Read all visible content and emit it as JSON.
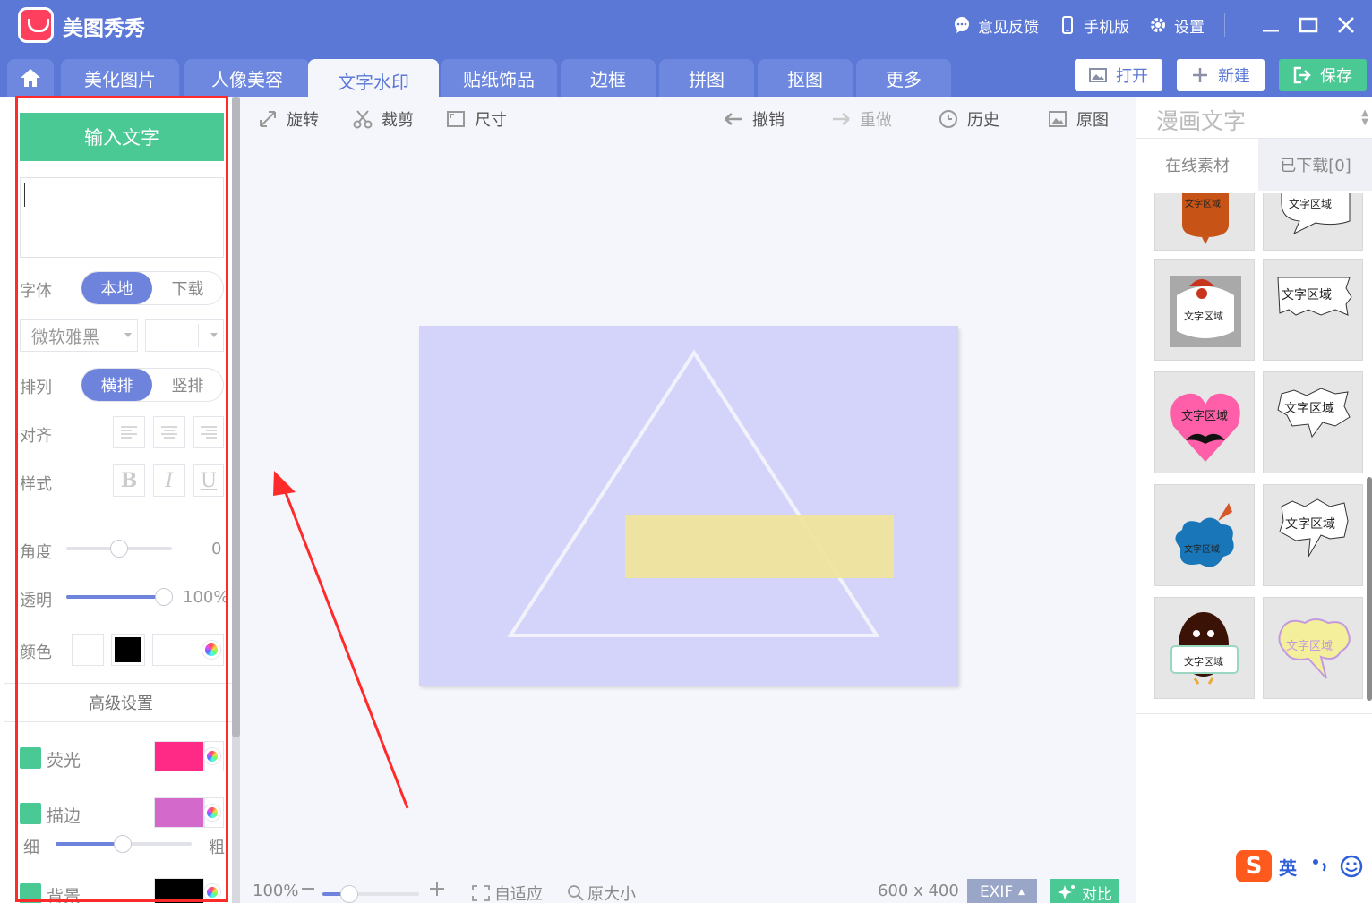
{
  "app": {
    "title": "美图秀秀"
  },
  "topbar": {
    "feedback": "意见反馈",
    "mobile": "手机版",
    "settings": "设置"
  },
  "nav": {
    "tabs": [
      "美化图片",
      "人像美容",
      "文字水印",
      "贴纸饰品",
      "边框",
      "拼图",
      "抠图",
      "更多"
    ],
    "active_tab": "文字水印",
    "open": "打开",
    "new": "新建",
    "save": "保存"
  },
  "left": {
    "input_button": "输入文字",
    "font_label": "字体",
    "font_local": "本地",
    "font_download": "下载",
    "font_value": "微软雅黑",
    "arrange_label": "排列",
    "horizontal": "横排",
    "vertical": "竖排",
    "align_label": "对齐",
    "style_label": "样式",
    "bold": "B",
    "italic": "I",
    "underline": "U",
    "angle_label": "角度",
    "angle_value": "0",
    "opacity_label": "透明",
    "opacity_value": "100%",
    "color_label": "颜色",
    "advanced": "高级设置",
    "glow_label": "荧光",
    "glow_color": "#ff2a85",
    "stroke_label": "描边",
    "stroke_color": "#d36acb",
    "thin": "细",
    "thick": "粗",
    "background_label": "背景",
    "background_color": "#000000"
  },
  "toolbar": {
    "rotate": "旋转",
    "crop": "裁剪",
    "size": "尺寸",
    "undo": "撤销",
    "redo": "重做",
    "history": "历史",
    "original": "原图"
  },
  "status": {
    "zoom": "100%",
    "fit": "自适应",
    "actual": "原大小",
    "dimensions": "600 x 400",
    "exif": "EXIF",
    "compare": "对比"
  },
  "right": {
    "title": "漫画文字",
    "tab_online": "在线素材",
    "tab_downloaded": "已下载[0]",
    "bubble_text": "文字区域"
  },
  "ime": {
    "mode": "英"
  },
  "colors": {
    "accent": "#5b78d6",
    "green": "#4ac994",
    "canvas": "#d4d4fb",
    "yellow_rect": "#efe49c"
  }
}
